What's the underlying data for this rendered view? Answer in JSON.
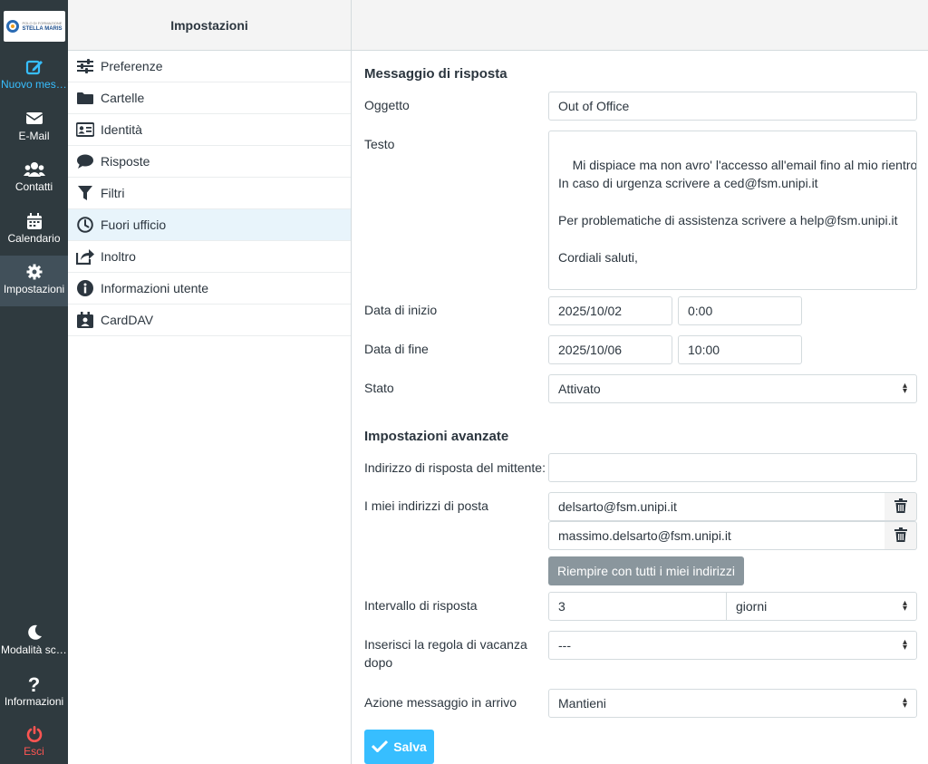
{
  "nav": {
    "logo_small": "POLO DI FORMAZIONE",
    "logo_big": "STELLA MARIS",
    "compose": "Nuovo messaggio",
    "mail": "E-Mail",
    "contacts": "Contatti",
    "calendar": "Calendario",
    "settings": "Impostazioni",
    "dark_mode": "Modalità scura",
    "about": "Informazioni",
    "logout": "Esci"
  },
  "settings_panel": {
    "title": "Impostazioni",
    "items": [
      {
        "label": "Preferenze",
        "icon": "sliders-icon"
      },
      {
        "label": "Cartelle",
        "icon": "folder-icon"
      },
      {
        "label": "Identità",
        "icon": "id-card-icon"
      },
      {
        "label": "Risposte",
        "icon": "comment-icon"
      },
      {
        "label": "Filtri",
        "icon": "filter-icon"
      },
      {
        "label": "Fuori ufficio",
        "icon": "clock-icon"
      },
      {
        "label": "Inoltro",
        "icon": "share-icon"
      },
      {
        "label": "Informazioni utente",
        "icon": "info-icon"
      },
      {
        "label": "CardDAV",
        "icon": "address-book-icon"
      }
    ],
    "active_index": 5
  },
  "form": {
    "section_reply": "Messaggio di risposta",
    "subject_label": "Oggetto",
    "subject_value": "Out of Office",
    "body_label": "Testo",
    "body_value": "Mi dispiace ma non avro' l'accesso all'email fino al mio rientro\nIn caso di urgenza scrivere a ced@fsm.unipi.it\n\nPer problematiche di assistenza scrivere a help@fsm.unipi.it\n\nCordiali saluti,\n\n Massimo Del Sarto",
    "start_label": "Data di inizio",
    "start_date": "2025/10/02",
    "start_time": "0:00",
    "end_label": "Data di fine",
    "end_date": "2025/10/06",
    "end_time": "10:00",
    "status_label": "Stato",
    "status_value": "Attivato",
    "section_advanced": "Impostazioni avanzate",
    "reply_to_label": "Indirizzo di risposta del mittente:",
    "reply_to_value": "",
    "my_addresses_label": "I miei indirizzi di posta",
    "addresses": [
      "delsarto@fsm.unipi.it",
      "massimo.delsarto@fsm.unipi.it"
    ],
    "fill_all_button": "Riempire con tutti i miei indirizzi",
    "interval_label": "Intervallo di risposta",
    "interval_value": "3",
    "interval_unit": "giorni",
    "insert_after_label": "Inserisci la regola di vacanza dopo",
    "insert_after_value": "---",
    "action_label": "Azione messaggio in arrivo",
    "action_value": "Mantieni",
    "save_button": "Salva"
  },
  "colors": {
    "nav_bg": "#2f3a3f",
    "accent": "#37beff",
    "logout": "#ff5552",
    "grey_button": "#8a969d"
  }
}
